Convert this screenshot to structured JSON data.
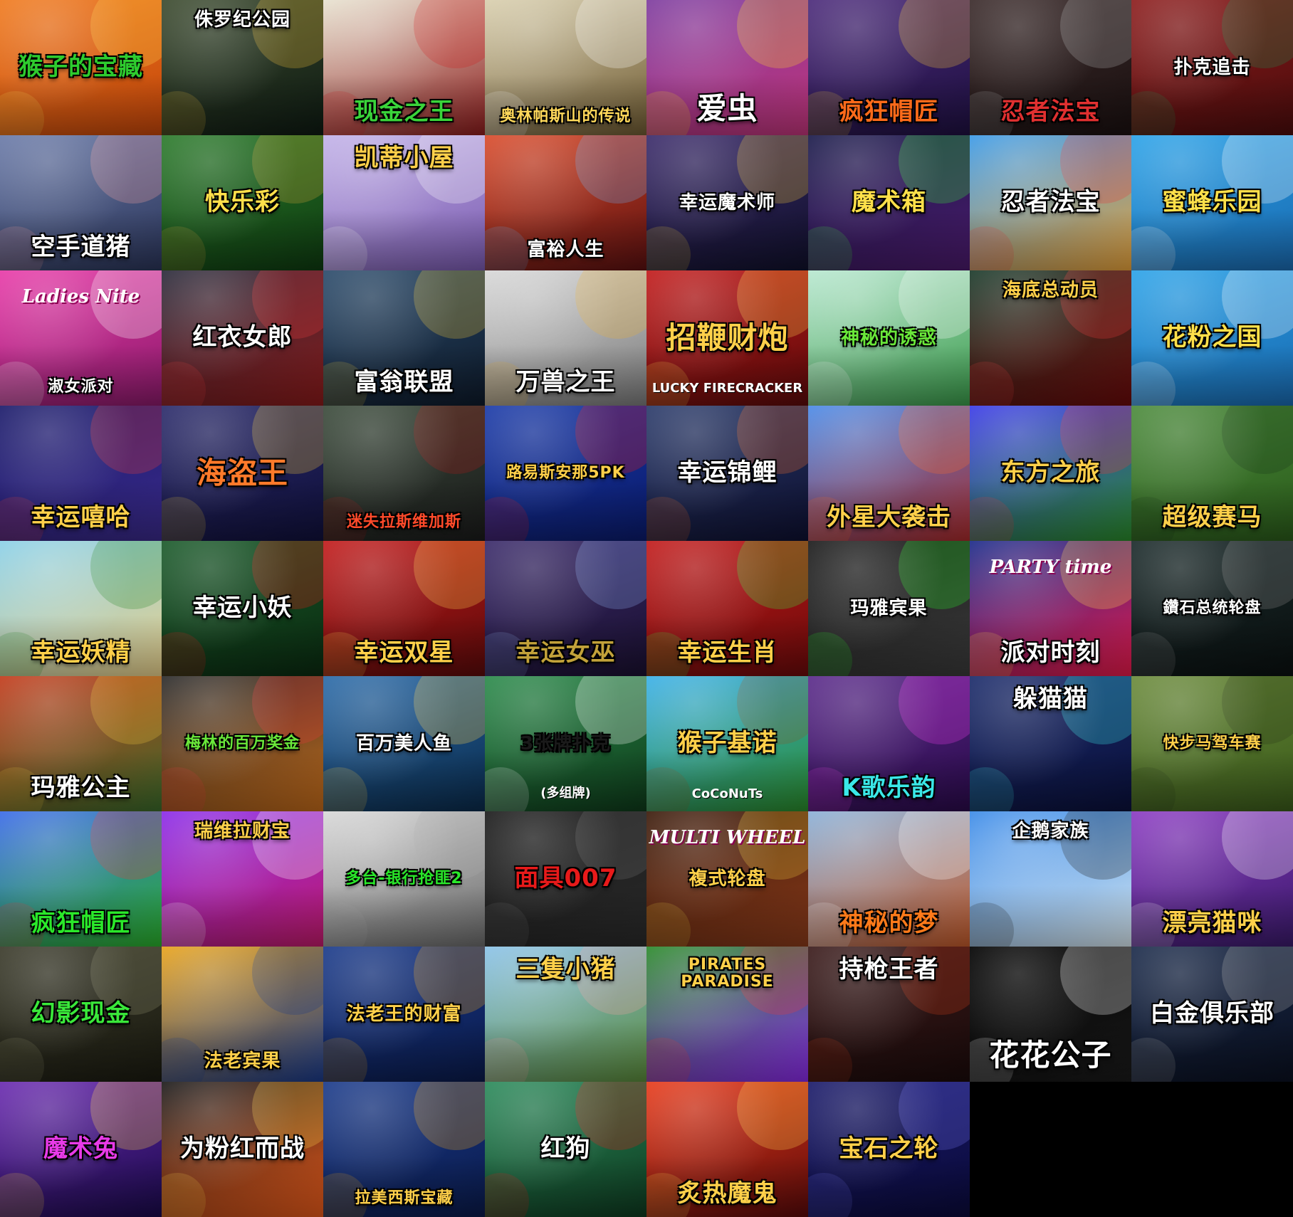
{
  "tiles": [
    {
      "title": "猴子的宝藏",
      "bg": [
        "#f07a1e",
        "#c2450a"
      ],
      "color": "#2ecc2e",
      "deco": "#ffd24a",
      "size": "",
      "pos": "",
      "eng": "",
      "sub": ""
    },
    {
      "title": "侏罗纪公园",
      "bg": [
        "#3b4a2e",
        "#0e1a12"
      ],
      "color": "#ffffff",
      "deco": "#e7b73a",
      "size": "sm",
      "pos": "top",
      "eng": "",
      "sub": ""
    },
    {
      "title": "现金之王",
      "bg": [
        "#e8e2d0",
        "#8c1c1c"
      ],
      "color": "#3ad43a",
      "deco": "#d12020",
      "size": "",
      "pos": "bottom",
      "eng": "",
      "sub": ""
    },
    {
      "title": "奥林帕斯山的传说",
      "bg": [
        "#d9cfae",
        "#6e5a32"
      ],
      "color": "#ffd85a",
      "deco": "#ffffff",
      "size": "xs",
      "pos": "bottom",
      "eng": "",
      "sub": ""
    },
    {
      "title": "爱虫",
      "bg": [
        "#7d3b9e",
        "#c2357a"
      ],
      "color": "#ffffff",
      "deco": "#ffd52a",
      "size": "lg",
      "pos": "bottom",
      "eng": "",
      "sub": ""
    },
    {
      "title": "疯狂帽匠",
      "bg": [
        "#4b2a7a",
        "#1e1040"
      ],
      "color": "#ff6a1a",
      "deco": "#f2c23a",
      "size": "",
      "pos": "bottom",
      "eng": "",
      "sub": ""
    },
    {
      "title": "忍者法宝",
      "bg": [
        "#3a2a2a",
        "#1a1010"
      ],
      "color": "#e03030",
      "deco": "#aaaaaa",
      "size": "",
      "pos": "bottom",
      "eng": "",
      "sub": ""
    },
    {
      "title": "扑克追击",
      "bg": [
        "#8c1c1c",
        "#4a0c0c"
      ],
      "color": "#ffffff",
      "deco": "#1e8a4a",
      "size": "sm",
      "pos": "",
      "eng": "",
      "sub": ""
    },
    {
      "title": "空手道猪",
      "bg": [
        "#6a7aa8",
        "#2a3458"
      ],
      "color": "#ffffff",
      "deco": "#f2a0a0",
      "size": "",
      "pos": "bottom",
      "eng": "",
      "sub": ""
    },
    {
      "title": "快乐彩",
      "bg": [
        "#2a7a2a",
        "#0e3a10"
      ],
      "color": "#ffe04a",
      "deco": "#c8a23a",
      "size": "",
      "pos": "",
      "eng": "",
      "sub": ""
    },
    {
      "title": "凯蒂小屋",
      "bg": [
        "#c2b2e8",
        "#7a5ab0"
      ],
      "color": "#ffd04a",
      "deco": "#ffffff",
      "size": "",
      "pos": "top",
      "eng": "",
      "sub": ""
    },
    {
      "title": "富裕人生",
      "bg": [
        "#d94a2a",
        "#5a1010"
      ],
      "color": "#ffffff",
      "deco": "#6aa8e8",
      "size": "sm",
      "pos": "bottom",
      "eng": "",
      "sub": ""
    },
    {
      "title": "幸运魔术师",
      "bg": [
        "#3a2a6a",
        "#10102a"
      ],
      "color": "#ffffff",
      "deco": "#e8c23a",
      "size": "sm",
      "pos": "",
      "eng": "",
      "sub": ""
    },
    {
      "title": "魔术箱",
      "bg": [
        "#1a1a4a",
        "#4a1a6a"
      ],
      "color": "#ffe04a",
      "deco": "#3ae83a",
      "size": "",
      "pos": "",
      "eng": "",
      "sub": ""
    },
    {
      "title": "忍者法宝",
      "bg": [
        "#3a9ae8",
        "#e8a23a"
      ],
      "color": "#ffffff",
      "deco": "#e83a3a",
      "size": "",
      "pos": "",
      "eng": "",
      "sub": ""
    },
    {
      "title": "蜜蜂乐园",
      "bg": [
        "#2aa2e8",
        "#1a6ab0"
      ],
      "color": "#ffe04a",
      "deco": "#ffffff",
      "size": "",
      "pos": "",
      "eng": "",
      "sub": ""
    },
    {
      "title": "淑女派对",
      "bg": [
        "#e83aa8",
        "#8a1a6a"
      ],
      "color": "#ffffff",
      "deco": "#ffffff",
      "size": "xs",
      "pos": "bottom",
      "eng": "Ladies Nite",
      "sub": ""
    },
    {
      "title": "红衣女郎",
      "bg": [
        "#2a2a3a",
        "#8a1a1a"
      ],
      "color": "#ffffff",
      "deco": "#e83a3a",
      "size": "",
      "pos": "",
      "eng": "",
      "sub": ""
    },
    {
      "title": "富翁联盟",
      "bg": [
        "#2a4a6a",
        "#0e1a2a"
      ],
      "color": "#ffffff",
      "deco": "#e8c23a",
      "size": "",
      "pos": "bottom",
      "eng": "",
      "sub": ""
    },
    {
      "title": "万兽之王",
      "bg": [
        "#d8d8d8",
        "#7a7a7a"
      ],
      "color": "#ffffff",
      "deco": "#e8b03a",
      "size": "",
      "pos": "bottom",
      "eng": "",
      "sub": ""
    },
    {
      "title": "招鞭财炮",
      "bg": [
        "#c21a1a",
        "#5a0a0a"
      ],
      "color": "#ffd04a",
      "deco": "#ffd04a",
      "size": "lg",
      "pos": "",
      "eng": "",
      "sub": "LUCKY FIRECRACKER"
    },
    {
      "title": "神秘的诱惑",
      "bg": [
        "#b8e8d0",
        "#3a9a4a"
      ],
      "color": "#6ae83a",
      "deco": "#ffffff",
      "size": "sm",
      "pos": "",
      "eng": "",
      "sub": ""
    },
    {
      "title": "海底总动员",
      "bg": [
        "#1a3a2a",
        "#6a0a0a"
      ],
      "color": "#ffd04a",
      "deco": "#e83a3a",
      "size": "sm",
      "pos": "top",
      "eng": "",
      "sub": ""
    },
    {
      "title": "花粉之国",
      "bg": [
        "#2aa2e8",
        "#1a6ab0"
      ],
      "color": "#ffe04a",
      "deco": "#ffffff",
      "size": "",
      "pos": "",
      "eng": "",
      "sub": ""
    },
    {
      "title": "幸运嘻哈",
      "bg": [
        "#1a1a6a",
        "#3a2a8a"
      ],
      "color": "#ffd04a",
      "deco": "#e83a3a",
      "size": "",
      "pos": "bottom",
      "eng": "",
      "sub": ""
    },
    {
      "title": "海盗王",
      "bg": [
        "#2a2a6a",
        "#10103a"
      ],
      "color": "#ff7a2a",
      "deco": "#e8c23a",
      "size": "lg",
      "pos": "",
      "eng": "",
      "sub": ""
    },
    {
      "title": "迷失拉斯维加斯",
      "bg": [
        "#3a4a3a",
        "#1a1a1a"
      ],
      "color": "#ff4a2a",
      "deco": "#aa1a1a",
      "size": "xs",
      "pos": "bottom",
      "eng": "",
      "sub": ""
    },
    {
      "title": "路易斯安那5PK",
      "bg": [
        "#1a3aa8",
        "#0a1a6a"
      ],
      "color": "#ffd04a",
      "deco": "#e81a1a",
      "size": "xs",
      "pos": "",
      "eng": "",
      "sub": ""
    },
    {
      "title": "幸运锦鲤",
      "bg": [
        "#2a3a6a",
        "#0e1030"
      ],
      "color": "#ffffff",
      "deco": "#e86a2a",
      "size": "",
      "pos": "",
      "eng": "",
      "sub": ""
    },
    {
      "title": "外星大袭击",
      "bg": [
        "#4a8ae8",
        "#a82a2a"
      ],
      "color": "#ffd04a",
      "deco": "#ff6a2a",
      "size": "",
      "pos": "bottom",
      "eng": "",
      "sub": ""
    },
    {
      "title": "东方之旅",
      "bg": [
        "#3a3ae8",
        "#2a8a2a"
      ],
      "color": "#ffd04a",
      "deco": "#e83a3a",
      "size": "",
      "pos": "",
      "eng": "",
      "sub": ""
    },
    {
      "title": "超级赛马",
      "bg": [
        "#4a8a3a",
        "#2a5a1a"
      ],
      "color": "#ffd04a",
      "deco": "#1a3a1a",
      "size": "",
      "pos": "bottom",
      "eng": "",
      "sub": ""
    },
    {
      "title": "幸运妖精",
      "bg": [
        "#8ad0e8",
        "#e8d08a"
      ],
      "color": "#ffd04a",
      "deco": "#2a8a2a",
      "size": "",
      "pos": "bottom",
      "eng": "",
      "sub": ""
    },
    {
      "title": "幸运小妖",
      "bg": [
        "#1a5a2a",
        "#0a2a10"
      ],
      "color": "#ffffff",
      "deco": "#e81a1a",
      "size": "",
      "pos": "",
      "eng": "",
      "sub": ""
    },
    {
      "title": "幸运双星",
      "bg": [
        "#c21a1a",
        "#5a0a0a"
      ],
      "color": "#ffd04a",
      "deco": "#ffd04a",
      "size": "",
      "pos": "bottom",
      "eng": "",
      "sub": ""
    },
    {
      "title": "幸运女巫",
      "bg": [
        "#3a2a6a",
        "#1a1030"
      ],
      "color": "#c2a23a",
      "deco": "#8aa8e8",
      "size": "",
      "pos": "bottom",
      "eng": "",
      "sub": ""
    },
    {
      "title": "幸运生肖",
      "bg": [
        "#c21a1a",
        "#6a0a0a"
      ],
      "color": "#ffd04a",
      "deco": "#3ae83a",
      "size": "",
      "pos": "bottom",
      "eng": "",
      "sub": ""
    },
    {
      "title": "玛雅宾果",
      "bg": [
        "#1a1a1a",
        "#3a3a3a"
      ],
      "color": "#ffffff",
      "deco": "#2ae82a",
      "size": "sm",
      "pos": "",
      "eng": "",
      "sub": ""
    },
    {
      "title": "派对时刻",
      "bg": [
        "#1a2a8a",
        "#e81a4a"
      ],
      "color": "#ffffff",
      "deco": "#ffd04a",
      "size": "",
      "pos": "bottom",
      "eng": "PARTY time",
      "sub": ""
    },
    {
      "title": "鑽石总统轮盘",
      "bg": [
        "#1a2a2a",
        "#0a1010"
      ],
      "color": "#ffffff",
      "deco": "#8a8a8a",
      "size": "xs",
      "pos": "",
      "eng": "",
      "sub": ""
    },
    {
      "title": "玛雅公主",
      "bg": [
        "#c23a1a",
        "#3a6a2a"
      ],
      "color": "#ffffff",
      "deco": "#e8c23a",
      "size": "",
      "pos": "bottom",
      "eng": "",
      "sub": ""
    },
    {
      "title": "梅林的百万奖金",
      "bg": [
        "#2a2a2a",
        "#c26a1a"
      ],
      "color": "#6ae83a",
      "deco": "#e83a3a",
      "size": "xs",
      "pos": "",
      "eng": "",
      "sub": ""
    },
    {
      "title": "百万美人鱼",
      "bg": [
        "#2a6aa8",
        "#0a2a4a"
      ],
      "color": "#ffffff",
      "deco": "#ffd04a",
      "size": "sm",
      "pos": "",
      "eng": "",
      "sub": ""
    },
    {
      "title": "3张牌扑克",
      "bg": [
        "#2a8a4a",
        "#0e3a1a"
      ],
      "color": "#1a1a1a",
      "deco": "#ffffff",
      "size": "sm",
      "pos": "",
      "eng": "",
      "sub": "(多组牌)"
    },
    {
      "title": "猴子基诺",
      "bg": [
        "#3ab0e8",
        "#2a8a2a"
      ],
      "color": "#ffd04a",
      "deco": "#8a5a2a",
      "size": "",
      "pos": "",
      "eng": "",
      "sub": "CoCoNuTs"
    },
    {
      "title": "K歌乐韵",
      "bg": [
        "#5a2a8a",
        "#2a0a4a"
      ],
      "color": "#3ae8e8",
      "deco": "#e83ae8",
      "size": "",
      "pos": "bottom",
      "eng": "",
      "sub": ""
    },
    {
      "title": "躲猫猫",
      "bg": [
        "#1a2a6a",
        "#0a103a"
      ],
      "color": "#ffffff",
      "deco": "#3ae8e8",
      "size": "",
      "pos": "top",
      "eng": "",
      "sub": ""
    },
    {
      "title": "快步马驾车赛",
      "bg": [
        "#6a8a3a",
        "#3a5a1a"
      ],
      "color": "#ffd04a",
      "deco": "#2a3a1a",
      "size": "xs",
      "pos": "",
      "eng": "",
      "sub": ""
    },
    {
      "title": "疯狂帽匠",
      "bg": [
        "#3a6ae8",
        "#2ab02a"
      ],
      "color": "#2ae82a",
      "deco": "#e83a3a",
      "size": "",
      "pos": "bottom",
      "eng": "",
      "sub": ""
    },
    {
      "title": "瑞维拉财宝",
      "bg": [
        "#8a2ae8",
        "#c21a6a"
      ],
      "color": "#ffd04a",
      "deco": "#ffffff",
      "size": "sm",
      "pos": "top",
      "eng": "",
      "sub": ""
    },
    {
      "title": "多台-银行抢匪2",
      "bg": [
        "#d8d8d8",
        "#6a6a6a"
      ],
      "color": "#2ae82a",
      "deco": "#aaaaaa",
      "size": "xs",
      "pos": "",
      "eng": "",
      "sub": ""
    },
    {
      "title": "面具007",
      "bg": [
        "#1a1a1a",
        "#2a2a2a"
      ],
      "color": "#e81a1a",
      "deco": "#6a6a6a",
      "size": "",
      "pos": "",
      "eng": "",
      "sub": ""
    },
    {
      "title": "複式轮盘",
      "bg": [
        "#3a1a0a",
        "#8a3a1a"
      ],
      "color": "#ffd04a",
      "deco": "#e8c23a",
      "size": "sm",
      "pos": "",
      "eng": "MULTI WHEEL",
      "sub": ""
    },
    {
      "title": "神秘的梦",
      "bg": [
        "#8ab0d8",
        "#c25a2a"
      ],
      "color": "#ff7a1a",
      "deco": "#ffffff",
      "size": "",
      "pos": "bottom",
      "eng": "",
      "sub": ""
    },
    {
      "title": "企鹅家族",
      "bg": [
        "#3a8ae8",
        "#d8e8f0"
      ],
      "color": "#ffffff",
      "deco": "#1a1a1a",
      "size": "sm",
      "pos": "top",
      "eng": "",
      "sub": ""
    },
    {
      "title": "漂亮猫咪",
      "bg": [
        "#8a3ac2",
        "#3a1a6a"
      ],
      "color": "#ffd04a",
      "deco": "#ffffff",
      "size": "",
      "pos": "bottom",
      "eng": "",
      "sub": ""
    },
    {
      "title": "幻影现金",
      "bg": [
        "#3a3a2a",
        "#1a1a10"
      ],
      "color": "#3ae83a",
      "deco": "#8a8a6a",
      "size": "",
      "pos": "",
      "eng": "",
      "sub": ""
    },
    {
      "title": "法老宾果",
      "bg": [
        "#e8a21a",
        "#1a3a8a"
      ],
      "color": "#ffd04a",
      "deco": "#1a3a8a",
      "size": "sm",
      "pos": "bottom",
      "eng": "",
      "sub": ""
    },
    {
      "title": "法老王的财富",
      "bg": [
        "#1a3a8a",
        "#0a1a4a"
      ],
      "color": "#ffd04a",
      "deco": "#e8a21a",
      "size": "sm",
      "pos": "",
      "eng": "",
      "sub": ""
    },
    {
      "title": "三隻小猪",
      "bg": [
        "#8ac2e8",
        "#5a8a3a"
      ],
      "color": "#ffd04a",
      "deco": "#f2a0a0",
      "size": "",
      "pos": "top",
      "eng": "",
      "sub": ""
    },
    {
      "title": "PIRATES PARADISE",
      "bg": [
        "#2a8a2a",
        "#8a2ae8"
      ],
      "color": "#ffd04a",
      "deco": "#e83a3a",
      "size": "xs",
      "pos": "top",
      "eng": "",
      "sub": ""
    },
    {
      "title": "持枪王者",
      "bg": [
        "#3a1a1a",
        "#1a0a0a"
      ],
      "color": "#ffffff",
      "deco": "#c23a1a",
      "size": "",
      "pos": "top",
      "eng": "",
      "sub": ""
    },
    {
      "title": "花花公子",
      "bg": [
        "#000000",
        "#1a1a1a"
      ],
      "color": "#ffffff",
      "deco": "#ffffff",
      "size": "lg",
      "pos": "bottom",
      "eng": "",
      "sub": ""
    },
    {
      "title": "白金俱乐部",
      "bg": [
        "#1a2a4a",
        "#0a1020"
      ],
      "color": "#ffffff",
      "deco": "#aaaaaa",
      "size": "",
      "pos": "",
      "eng": "",
      "sub": ""
    },
    {
      "title": "魔术兔",
      "bg": [
        "#6a2ab0",
        "#1a0a4a"
      ],
      "color": "#e83ae8",
      "deco": "#ffd04a",
      "size": "",
      "pos": "",
      "eng": "",
      "sub": ""
    },
    {
      "title": "为粉红而战",
      "bg": [
        "#1a1a1a",
        "#e85a1a"
      ],
      "color": "#ffffff",
      "deco": "#ffd04a",
      "size": "",
      "pos": "",
      "eng": "",
      "sub": ""
    },
    {
      "title": "拉美西斯宝藏",
      "bg": [
        "#1a3a8a",
        "#0a1a4a"
      ],
      "color": "#ffd04a",
      "deco": "#e8a21a",
      "size": "xs",
      "pos": "bottom",
      "eng": "",
      "sub": ""
    },
    {
      "title": "红狗",
      "bg": [
        "#2a8a5a",
        "#0e3a20"
      ],
      "color": "#ffffff",
      "deco": "#e81a1a",
      "size": "",
      "pos": "",
      "eng": "",
      "sub": ""
    },
    {
      "title": "炙热魔鬼",
      "bg": [
        "#e83a1a",
        "#5a0a0a"
      ],
      "color": "#ffd04a",
      "deco": "#ffd04a",
      "size": "",
      "pos": "bottom",
      "eng": "",
      "sub": ""
    },
    {
      "title": "宝石之轮",
      "bg": [
        "#1a1a6a",
        "#0a0a3a"
      ],
      "color": "#ffd04a",
      "deco": "#6a6ae8",
      "size": "",
      "pos": "",
      "eng": "",
      "sub": ""
    }
  ]
}
